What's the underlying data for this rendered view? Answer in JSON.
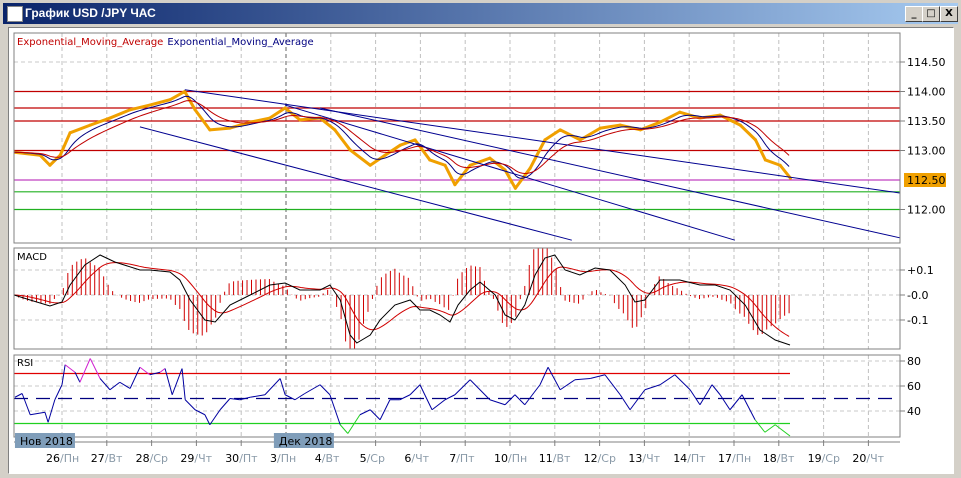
{
  "window": {
    "title": "График USD /JPY  ЧАС",
    "min": "_",
    "max": "□",
    "close": "X"
  },
  "chart_data": {
    "type": "line",
    "title": "График USD /JPY  ЧАС",
    "legend": [
      {
        "label": "Exponential_Moving_Average",
        "color": "#c00000"
      },
      {
        "label": "Exponential_Moving_Average",
        "color": "#000080"
      }
    ],
    "price": {
      "ylim": [
        111.5,
        114.85
      ],
      "yticks": [
        {
          "v": 114.5,
          "label": "114.50"
        },
        {
          "v": 114.0,
          "label": "114.00"
        },
        {
          "v": 113.5,
          "label": "113.50"
        },
        {
          "v": 113.0,
          "label": "113.00"
        },
        {
          "v": 112.0,
          "label": "112.00"
        }
      ],
      "current": {
        "v": 112.5,
        "label": "112.50",
        "color": "#f0a000"
      },
      "t": [
        -1.07,
        -0.49,
        -0.27,
        -0.04,
        0.18,
        0.63,
        1.07,
        1.52,
        1.96,
        2.41,
        2.74,
        2.97,
        3.3,
        3.75,
        4.2,
        4.64,
        4.98,
        5.31,
        5.76,
        6.09,
        6.43,
        6.88,
        7.21,
        7.55,
        7.88,
        8.21,
        8.55,
        8.77,
        9.11,
        9.55,
        9.89,
        10.12,
        10.45,
        10.78,
        11.12,
        11.57,
        12.02,
        12.46,
        12.91,
        13.35,
        13.79,
        14.24,
        14.69,
        15.14,
        15.48,
        15.7,
        16.03,
        16.26
      ],
      "close": [
        112.97,
        112.92,
        112.75,
        112.92,
        113.3,
        113.43,
        113.55,
        113.69,
        113.77,
        113.86,
        114.0,
        113.69,
        113.35,
        113.38,
        113.48,
        113.55,
        113.72,
        113.52,
        113.55,
        113.35,
        113.01,
        112.75,
        112.92,
        113.09,
        113.18,
        112.84,
        112.75,
        112.42,
        112.75,
        112.87,
        112.67,
        112.36,
        112.7,
        113.18,
        113.35,
        113.18,
        113.38,
        113.43,
        113.35,
        113.48,
        113.65,
        113.55,
        113.6,
        113.43,
        113.18,
        112.84,
        112.75,
        112.53
      ]
    },
    "hlines": [
      {
        "v": 114.0,
        "color": "#c00000"
      },
      {
        "v": 113.72,
        "color": "#c00000"
      },
      {
        "v": 113.5,
        "color": "#c00000"
      },
      {
        "v": 113.0,
        "color": "#c00000"
      },
      {
        "v": 112.5,
        "color": "#c040c0"
      },
      {
        "v": 112.3,
        "color": "#20b020"
      },
      {
        "v": 112.0,
        "color": "#20b020"
      }
    ],
    "trendlines": [
      {
        "t1": 2.74,
        "p1": 114.03,
        "t2": 18.7,
        "p2": 112.28
      },
      {
        "t1": 4.98,
        "p1": 113.77,
        "t2": 15.02,
        "p2": 111.48
      },
      {
        "t1": 1.74,
        "p1": 113.4,
        "t2": 11.38,
        "p2": 111.48
      },
      {
        "t1": 5.76,
        "p1": 113.72,
        "t2": 18.7,
        "p2": 111.52
      }
    ],
    "macd": {
      "label": "MACD",
      "yticks": [
        {
          "v": 0.1,
          "label": "+0.1"
        },
        {
          "v": 0,
          "label": "-0.0"
        },
        {
          "v": -0.1,
          "label": "-0.1"
        }
      ],
      "t": [
        -1.07,
        -0.71,
        -0.27,
        0,
        0.18,
        0.51,
        0.85,
        1.18,
        1.74,
        1.96,
        2.41,
        2.63,
        2.86,
        3.19,
        3.42,
        3.75,
        4.2,
        4.64,
        4.98,
        5.31,
        5.76,
        5.98,
        6.21,
        6.43,
        6.58,
        6.88,
        7.1,
        7.43,
        7.77,
        7.99,
        8.21,
        8.44,
        8.66,
        8.84,
        9.11,
        9.33,
        9.67,
        9.89,
        10.11,
        10.33,
        10.56,
        10.78,
        11.0,
        11.23,
        11.56,
        11.9,
        12.23,
        12.57,
        12.79,
        13.01,
        13.35,
        13.79,
        14.24,
        14.58,
        14.91,
        15.25,
        15.58,
        15.92,
        16.25
      ],
      "values": [
        0,
        -0.02,
        -0.044,
        -0.028,
        0.04,
        0.12,
        0.16,
        0.132,
        0.1,
        0.1,
        0.092,
        0.06,
        -0.02,
        -0.1,
        -0.108,
        -0.04,
        0,
        0.04,
        0.048,
        0.02,
        0.02,
        0.04,
        -0.02,
        -0.16,
        -0.192,
        -0.16,
        -0.1,
        -0.04,
        -0.02,
        -0.06,
        -0.06,
        -0.08,
        -0.108,
        -0.04,
        0.02,
        0.052,
        0,
        -0.08,
        -0.1,
        -0.04,
        0.08,
        0.148,
        0.16,
        0.1,
        0.08,
        0.108,
        0.1,
        0.04,
        -0.028,
        -0.02,
        0.06,
        0.06,
        0.04,
        0.04,
        0.02,
        -0.04,
        -0.14,
        -0.18,
        -0.2
      ]
    },
    "rsi": {
      "label": "RSI",
      "levels": [
        {
          "v": 70,
          "color": "#e00000"
        },
        {
          "v": 50,
          "color": "#000080"
        },
        {
          "v": 30,
          "color": "#20d020"
        }
      ],
      "yticks": [
        {
          "v": 80,
          "label": "80"
        },
        {
          "v": 60,
          "label": "60"
        },
        {
          "v": 40,
          "label": "40"
        }
      ],
      "t": [
        -1.05,
        -0.89,
        -0.71,
        -0.38,
        -0.31,
        -0.16,
        0,
        0.07,
        0.29,
        0.4,
        0.63,
        0.85,
        1.07,
        1.29,
        1.52,
        1.74,
        1.96,
        2.19,
        2.3,
        2.46,
        2.68,
        2.75,
        2.97,
        3.19,
        3.3,
        3.53,
        3.75,
        3.97,
        4.2,
        4.53,
        4.87,
        4.98,
        5.2,
        5.42,
        5.76,
        5.98,
        6.21,
        6.38,
        6.65,
        6.88,
        7.1,
        7.32,
        7.54,
        7.77,
        7.99,
        8.26,
        8.55,
        8.77,
        9.11,
        9.55,
        9.89,
        10.11,
        10.33,
        10.67,
        10.85,
        11.12,
        11.45,
        11.79,
        12.12,
        12.46,
        12.68,
        13.01,
        13.35,
        13.68,
        14.02,
        14.24,
        14.51,
        14.69,
        14.91,
        15.18,
        15.47,
        15.69,
        15.92,
        16.03,
        16.25
      ],
      "values": [
        51,
        54,
        37,
        39,
        31,
        49,
        61,
        77,
        71,
        63,
        82,
        66,
        57,
        63,
        58,
        75,
        69,
        71,
        74,
        53,
        74,
        49,
        41,
        37,
        29,
        41,
        50,
        49,
        51,
        53,
        66,
        53,
        49,
        54,
        61,
        53,
        29,
        22,
        37,
        41,
        33,
        49,
        49,
        53,
        61,
        41,
        49,
        53,
        65,
        49,
        45,
        53,
        45,
        61,
        75,
        57,
        65,
        66,
        69,
        53,
        41,
        57,
        61,
        69,
        57,
        45,
        61,
        53,
        41,
        53,
        33,
        23,
        29,
        26,
        20
      ]
    },
    "xaxis": {
      "months": [
        {
          "label": "Нов 2018",
          "t": -1.05
        },
        {
          "label": "Дек 2018",
          "t": 4.73
        }
      ],
      "ticks": [
        {
          "day": "26",
          "wd": "/Пн"
        },
        {
          "day": "27",
          "wd": "/Вт"
        },
        {
          "day": "28",
          "wd": "/Ср"
        },
        {
          "day": "29",
          "wd": "/Чт"
        },
        {
          "day": "30",
          "wd": "/Пт"
        },
        {
          "day": "3",
          "wd": "/Пн"
        },
        {
          "day": "4",
          "wd": "/Вт"
        },
        {
          "day": "5",
          "wd": "/Ср"
        },
        {
          "day": "6",
          "wd": "/Чт"
        },
        {
          "day": "7",
          "wd": "/Пт"
        },
        {
          "day": "10",
          "wd": "/Пн"
        },
        {
          "day": "11",
          "wd": "/Вт"
        },
        {
          "day": "12",
          "wd": "/Ср"
        },
        {
          "day": "13",
          "wd": "/Чт"
        },
        {
          "day": "14",
          "wd": "/Пт"
        },
        {
          "day": "17",
          "wd": "/Пн"
        },
        {
          "day": "18",
          "wd": "/Вт"
        },
        {
          "day": "19",
          "wd": "/Ср"
        },
        {
          "day": "20",
          "wd": "/Чт"
        }
      ]
    }
  }
}
